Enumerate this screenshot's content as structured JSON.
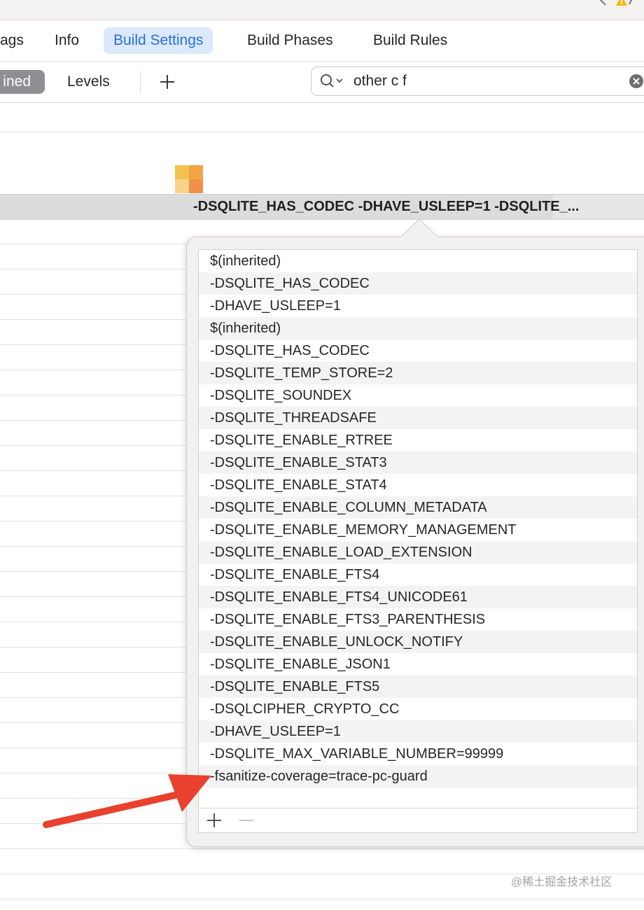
{
  "tabs": [
    {
      "label": "ags"
    },
    {
      "label": "Info"
    },
    {
      "label": "Build Settings"
    },
    {
      "label": "Build Phases"
    },
    {
      "label": "Build Rules"
    }
  ],
  "filter": {
    "combined_label": "ined",
    "levels_label": "Levels",
    "search_value": "other c f"
  },
  "setting_value": "-DSQLITE_HAS_CODEC -DHAVE_USLEEP=1  -DSQLITE_...",
  "flags": [
    "$(inherited)",
    "-DSQLITE_HAS_CODEC",
    "-DHAVE_USLEEP=1",
    "$(inherited)",
    "-DSQLITE_HAS_CODEC",
    "-DSQLITE_TEMP_STORE=2",
    "-DSQLITE_SOUNDEX",
    "-DSQLITE_THREADSAFE",
    "-DSQLITE_ENABLE_RTREE",
    "-DSQLITE_ENABLE_STAT3",
    "-DSQLITE_ENABLE_STAT4",
    "-DSQLITE_ENABLE_COLUMN_METADATA",
    "-DSQLITE_ENABLE_MEMORY_MANAGEMENT",
    "-DSQLITE_ENABLE_LOAD_EXTENSION",
    "-DSQLITE_ENABLE_FTS4",
    "-DSQLITE_ENABLE_FTS4_UNICODE61",
    "-DSQLITE_ENABLE_FTS3_PARENTHESIS",
    "-DSQLITE_ENABLE_UNLOCK_NOTIFY",
    "-DSQLITE_ENABLE_JSON1",
    "-DSQLITE_ENABLE_FTS5",
    "-DSQLCIPHER_CRYPTO_CC",
    "-DHAVE_USLEEP=1",
    "-DSQLITE_MAX_VARIABLE_NUMBER=99999",
    "-fsanitize-coverage=trace-pc-guard"
  ],
  "watermark": "@稀土掘金技术社区",
  "colors": {
    "accent": "#2670e0",
    "active_tab_bg": "#dce9fb",
    "annotation_arrow": "#e8412d",
    "warning": "#f5b800"
  },
  "icons": {
    "warning": "warning-icon",
    "search": "search-icon",
    "clear": "clear-icon",
    "add": "plus-icon",
    "remove": "minus-icon"
  }
}
